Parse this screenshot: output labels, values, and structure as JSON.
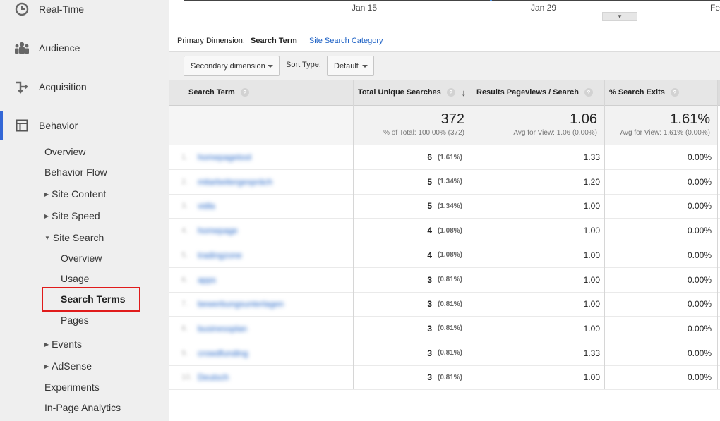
{
  "sidebar": {
    "main": [
      {
        "label": "Real-Time",
        "icon": "clock-icon"
      },
      {
        "label": "Audience",
        "icon": "people-icon"
      },
      {
        "label": "Acquisition",
        "icon": "acquisition-arrows-icon"
      },
      {
        "label": "Behavior",
        "icon": "behavior-layout-icon",
        "active": true
      }
    ],
    "behavior_items": {
      "overview": "Overview",
      "behavior_flow": "Behavior Flow",
      "site_content": "Site Content",
      "site_speed": "Site Speed",
      "site_search": "Site Search",
      "ss_overview": "Overview",
      "ss_usage": "Usage",
      "ss_search_terms": "Search Terms",
      "ss_pages": "Pages",
      "events": "Events",
      "adsense": "AdSense",
      "experiments": "Experiments",
      "in_page_analytics": "In-Page Analytics"
    },
    "highlight_color": "#e01b1b",
    "accent_color": "#3367d6"
  },
  "chart": {
    "x_ticks": [
      "Jan 15",
      "Jan 29",
      "Feb"
    ]
  },
  "dimension": {
    "label": "Primary Dimension:",
    "current": "Search Term",
    "alternative": "Site Search Category"
  },
  "toolbar": {
    "secondary_dimension": "Secondary dimension",
    "sort_type_label": "Sort Type:",
    "sort_value": "Default"
  },
  "table": {
    "headers": {
      "search_term": "Search Term",
      "unique_searches": "Total Unique Searches",
      "results_pageviews": "Results Pageviews / Search",
      "search_exits": "% Search Exits"
    },
    "help_icon": "?",
    "totals": {
      "unique_searches": "372",
      "unique_searches_sub": "% of Total: 100.00% (372)",
      "results_pageviews": "1.06",
      "results_pageviews_sub": "Avg for View: 1.06 (0.00%)",
      "search_exits": "1.61%",
      "search_exits_sub": "Avg for View: 1.61% (0.00%)"
    },
    "rows": [
      {
        "idx": "1.",
        "term": "homepagetool",
        "count": "6",
        "pct": "(1.61%)",
        "rpv": "1.33",
        "exits": "0.00%"
      },
      {
        "idx": "2.",
        "term": "mitarbeitergespräch",
        "count": "5",
        "pct": "(1.34%)",
        "rpv": "1.20",
        "exits": "0.00%"
      },
      {
        "idx": "3.",
        "term": "vidla",
        "count": "5",
        "pct": "(1.34%)",
        "rpv": "1.00",
        "exits": "0.00%"
      },
      {
        "idx": "4.",
        "term": "homepage",
        "count": "4",
        "pct": "(1.08%)",
        "rpv": "1.00",
        "exits": "0.00%"
      },
      {
        "idx": "5.",
        "term": "tradingzone",
        "count": "4",
        "pct": "(1.08%)",
        "rpv": "1.00",
        "exits": "0.00%"
      },
      {
        "idx": "6.",
        "term": "apps",
        "count": "3",
        "pct": "(0.81%)",
        "rpv": "1.00",
        "exits": "0.00%"
      },
      {
        "idx": "7.",
        "term": "bewerbungsunterlagen",
        "count": "3",
        "pct": "(0.81%)",
        "rpv": "1.00",
        "exits": "0.00%"
      },
      {
        "idx": "8.",
        "term": "businessplan",
        "count": "3",
        "pct": "(0.81%)",
        "rpv": "1.00",
        "exits": "0.00%"
      },
      {
        "idx": "9.",
        "term": "crowdfunding",
        "count": "3",
        "pct": "(0.81%)",
        "rpv": "1.33",
        "exits": "0.00%"
      },
      {
        "idx": "10.",
        "term": "Deutsch",
        "count": "3",
        "pct": "(0.81%)",
        "rpv": "1.00",
        "exits": "0.00%"
      }
    ]
  }
}
